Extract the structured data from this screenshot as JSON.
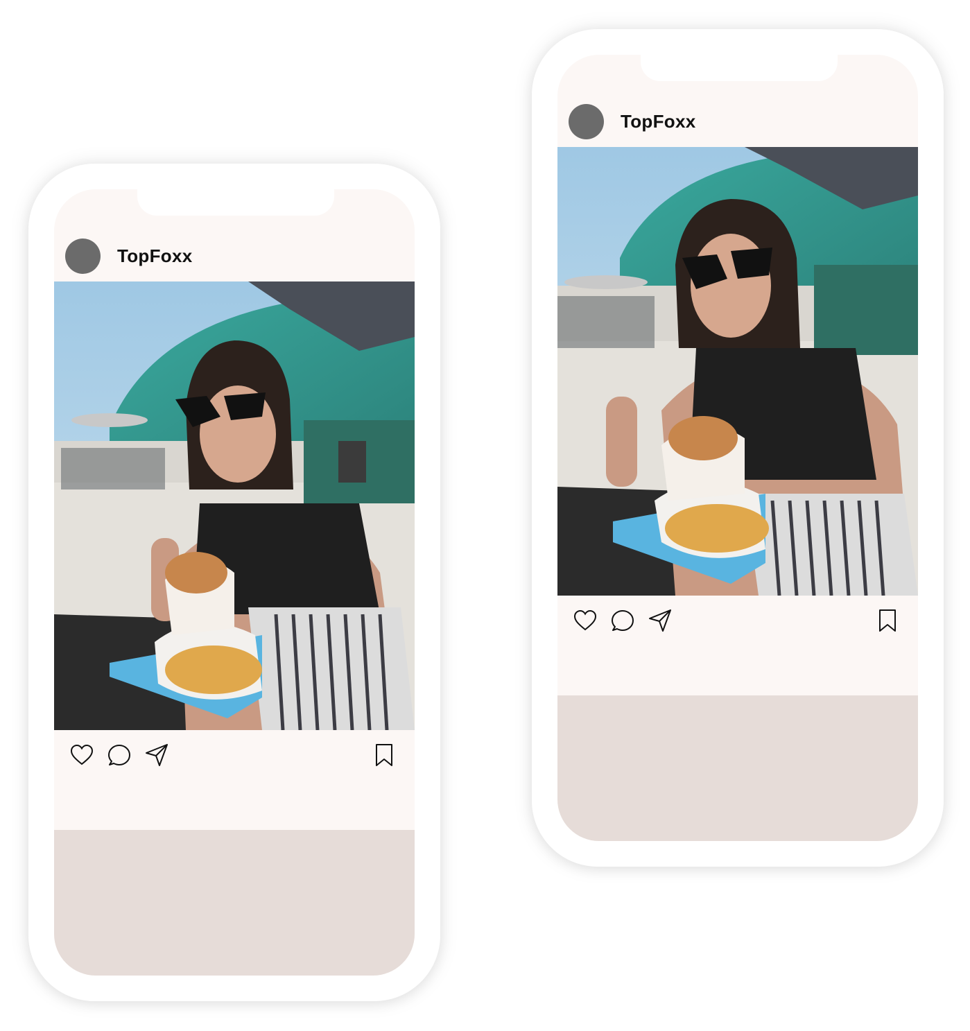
{
  "phones": [
    {
      "username": "TopFoxx",
      "icons": [
        "heart-icon",
        "comment-icon",
        "send-icon",
        "bookmark-icon"
      ]
    },
    {
      "username": "TopFoxx",
      "icons": [
        "heart-icon",
        "comment-icon",
        "send-icon",
        "bookmark-icon"
      ]
    }
  ],
  "colors": {
    "screen_bg": "#fcf7f5",
    "bottom_panel": "#e6dcd8",
    "avatar": "#6b6b6b"
  }
}
